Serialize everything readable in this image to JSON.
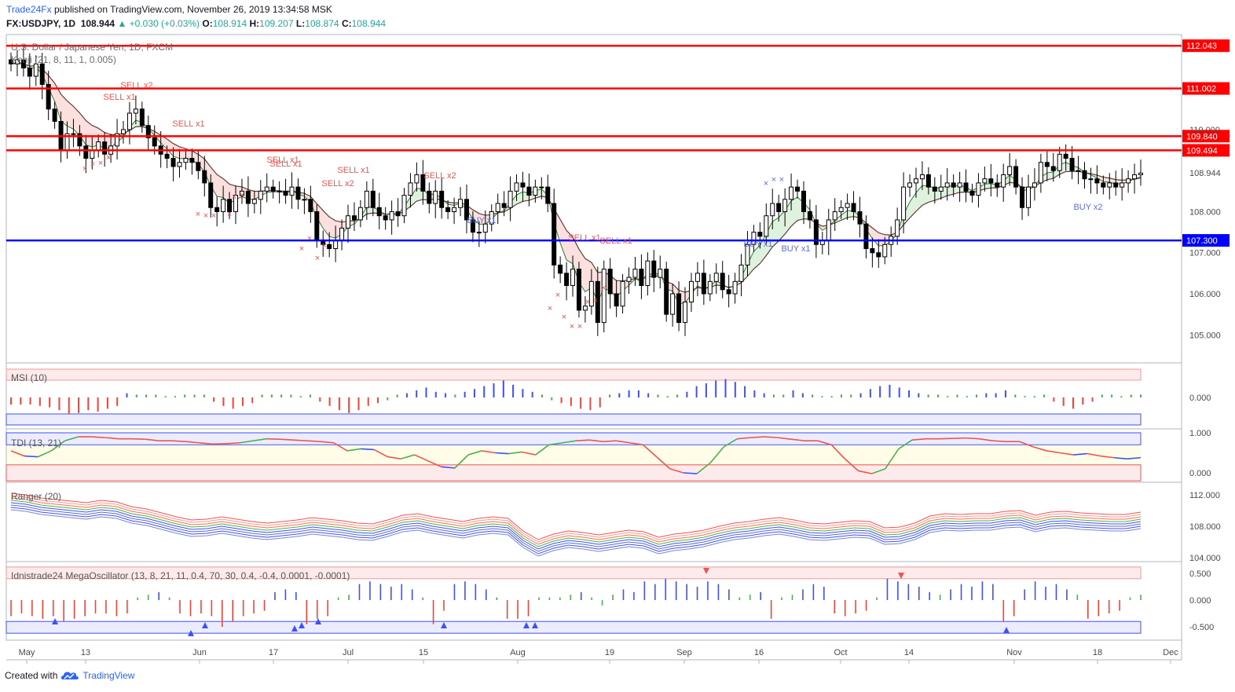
{
  "header": {
    "publisher": "Trade24Fx",
    "published_text": "published on TradingView.com, November 26, 2019 13:34:58 MSK",
    "symbol": "FX:USDJPY, 1D",
    "last": "108.944",
    "change": "▲ +0.030 (+0.03%)",
    "o_label": "O:",
    "o_value": "108.914",
    "h_label": "H:",
    "h_value": "109.207",
    "l_label": "L:",
    "l_value": "108.874",
    "c_label": "C:",
    "c_value": "108.944"
  },
  "footer": {
    "created_with": "Created with",
    "brand": "TradingView"
  },
  "colors": {
    "bull": "#ffffff",
    "bear": "#000000",
    "red_level": "#ff0000",
    "blue_level": "#0000ff",
    "sell": "#ef5350",
    "buy": "#5b6ee1",
    "up_bar": "#3f51f5",
    "down_bar": "#f44336",
    "neutral_bar": "#4caf50"
  },
  "chart_data": [
    {
      "pane": "price",
      "type": "candlestick",
      "title": "U.S. Dollar / Japanese Yen, 1D, FXCM",
      "indicator_label": "Kenji (21, 8, 11, 1, 0.005)",
      "ylim": [
        104.45,
        112.2
      ],
      "y_ticks": [
        "105.000",
        "106.000",
        "107.000",
        "108.000",
        "108.944",
        "110.000"
      ],
      "x_tick_labels": [
        "May",
        "13",
        "Jun",
        "17",
        "Jul",
        "15",
        "Aug",
        "19",
        "Sep",
        "16",
        "Oct",
        "14",
        "Nov",
        "18",
        "Dec"
      ],
      "horizontal_levels": [
        {
          "value": 112.043,
          "label": "112.043",
          "color": "red"
        },
        {
          "value": 111.002,
          "label": "111.002",
          "color": "red"
        },
        {
          "value": 109.84,
          "label": "109.840",
          "color": "red"
        },
        {
          "value": 109.494,
          "label": "109.494",
          "color": "red"
        },
        {
          "value": 107.3,
          "label": "107.300",
          "color": "blue"
        }
      ],
      "last_price_label": "108.944",
      "close": [
        111.6,
        111.7,
        111.5,
        111.3,
        111.6,
        111.1,
        110.5,
        110.2,
        109.5,
        109.9,
        109.9,
        109.6,
        109.3,
        109.5,
        109.7,
        109.4,
        109.6,
        109.9,
        110.0,
        110.4,
        110.5,
        110.1,
        109.8,
        109.6,
        109.4,
        109.3,
        109.1,
        109.2,
        109.3,
        109.2,
        109.0,
        108.7,
        108.1,
        108.0,
        108.3,
        108.0,
        108.4,
        108.5,
        108.2,
        108.3,
        108.5,
        108.6,
        108.5,
        108.5,
        108.4,
        108.6,
        108.3,
        108.3,
        108.0,
        107.3,
        107.2,
        107.1,
        107.3,
        107.6,
        107.9,
        107.8,
        108.1,
        108.5,
        108.1,
        107.9,
        107.8,
        108.0,
        107.9,
        108.4,
        108.7,
        108.9,
        108.5,
        108.2,
        108.5,
        108.1,
        108.0,
        108.1,
        108.3,
        107.8,
        107.5,
        107.5,
        107.7,
        108.0,
        108.2,
        108.1,
        108.5,
        108.7,
        108.6,
        108.4,
        108.6,
        108.6,
        108.2,
        106.7,
        106.5,
        106.2,
        106.6,
        105.6,
        105.7,
        106.3,
        105.3,
        106.6,
        106.0,
        105.7,
        106.3,
        106.4,
        106.6,
        106.2,
        106.8,
        106.4,
        106.6,
        105.5,
        106.0,
        105.3,
        105.8,
        106.3,
        106.5,
        106.0,
        106.3,
        106.5,
        106.1,
        106.0,
        106.3,
        106.7,
        107.2,
        107.5,
        107.4,
        107.9,
        108.2,
        108.0,
        108.3,
        108.6,
        108.5,
        108.0,
        107.8,
        107.2,
        107.3,
        107.8,
        108.0,
        108.1,
        108.2,
        108.0,
        107.7,
        107.1,
        107.0,
        106.9,
        107.2,
        107.4,
        107.8,
        108.6,
        108.7,
        108.8,
        108.9,
        108.6,
        108.5,
        108.6,
        108.7,
        108.6,
        108.7,
        108.5,
        108.4,
        108.7,
        108.8,
        108.7,
        108.6,
        108.9,
        109.1,
        108.6,
        108.1,
        108.6,
        108.7,
        109.2,
        109.1,
        109.0,
        109.4,
        109.3,
        109.0,
        109.0,
        108.8,
        108.8,
        108.7,
        108.6,
        108.7,
        108.6,
        108.7,
        108.8,
        108.9,
        108.94
      ]
    },
    {
      "pane": "msi",
      "type": "bar",
      "title": "MSI (10)",
      "y_ticks": [
        "0.000"
      ],
      "values": [
        -0.5,
        -0.5,
        -0.5,
        -0.6,
        -0.7,
        -0.9,
        -1.2,
        -1.1,
        -0.9,
        -1.0,
        -0.8,
        -0.6,
        0.3,
        0.2,
        0.2,
        0.2,
        0.1,
        0.1,
        0.2,
        0.2,
        0.2,
        -0.3,
        -0.6,
        -0.8,
        -0.6,
        -0.4,
        0.2,
        0.2,
        0.2,
        0.2,
        0.1,
        0.2,
        -0.3,
        -0.6,
        -0.9,
        -1.1,
        -0.9,
        -0.6,
        -0.4,
        -0.2,
        0.2,
        0.3,
        0.5,
        0.7,
        0.4,
        0.3,
        0.2,
        0.4,
        0.6,
        0.8,
        1.0,
        1.2,
        0.9,
        0.6,
        0.4,
        0.2,
        -0.2,
        -0.4,
        -0.6,
        -0.8,
        -0.9,
        -0.7,
        0.2,
        0.3,
        0.5,
        0.5,
        0.3,
        0.2,
        0.1,
        0.2,
        0.4,
        0.8,
        1.0,
        1.2,
        1.3,
        1.1,
        0.8,
        0.5,
        0.3,
        0.2,
        0.2,
        0.5,
        0.3,
        0.2,
        0.1,
        0.1,
        0.2,
        0.2,
        0.3,
        0.6,
        0.8,
        0.9,
        0.7,
        0.5,
        0.3,
        0.2,
        0.2,
        0.1,
        0.2,
        0.1,
        0.2,
        0.3,
        0.3,
        0.5,
        0.2,
        0.1,
        0.1,
        0.2,
        -0.3,
        -0.6,
        -0.8,
        -0.5,
        -0.3,
        0.2,
        0.2,
        0.1,
        0.2,
        0.2
      ]
    },
    {
      "pane": "tdi",
      "type": "line",
      "title": "TDI (13, 21)",
      "y_ticks": [
        "1.000",
        "0.000"
      ],
      "values": [
        0.55,
        0.42,
        0.4,
        0.55,
        0.8,
        0.9,
        0.9,
        0.88,
        0.85,
        0.85,
        0.84,
        0.8,
        0.8,
        0.78,
        0.75,
        0.72,
        0.73,
        0.75,
        0.8,
        0.85,
        0.84,
        0.82,
        0.8,
        0.78,
        0.75,
        0.55,
        0.6,
        0.58,
        0.4,
        0.35,
        0.45,
        0.3,
        0.15,
        0.12,
        0.45,
        0.55,
        0.5,
        0.48,
        0.52,
        0.45,
        0.7,
        0.75,
        0.8,
        0.82,
        0.78,
        0.8,
        0.75,
        0.7,
        0.4,
        0.1,
        0.0,
        -0.02,
        0.25,
        0.65,
        0.85,
        0.88,
        0.9,
        0.88,
        0.84,
        0.8,
        0.8,
        0.7,
        0.35,
        0.05,
        -0.02,
        0.1,
        0.6,
        0.82,
        0.85,
        0.85,
        0.86,
        0.87,
        0.85,
        0.8,
        0.78,
        0.78,
        0.65,
        0.55,
        0.5,
        0.45,
        0.48,
        0.42,
        0.38,
        0.35,
        0.38
      ]
    },
    {
      "pane": "ranger",
      "type": "line",
      "title": "Ranger (20)",
      "y_ticks": [
        "112.000",
        "108.000",
        "104.000"
      ],
      "values": [
        111.2,
        111.0,
        110.6,
        110.4,
        110.2,
        110.0,
        110.3,
        110.1,
        109.5,
        109.2,
        108.7,
        108.2,
        107.8,
        107.9,
        108.2,
        107.9,
        107.6,
        107.4,
        107.6,
        107.8,
        108.1,
        107.9,
        107.7,
        107.4,
        107.3,
        107.8,
        108.4,
        108.6,
        108.2,
        107.9,
        107.6,
        108.0,
        108.2,
        108.0,
        106.4,
        105.3,
        106.0,
        106.4,
        106.2,
        105.9,
        106.2,
        106.5,
        106.3,
        105.6,
        106.0,
        106.2,
        106.5,
        107.0,
        107.4,
        107.6,
        107.9,
        108.1,
        107.8,
        107.4,
        107.3,
        107.5,
        107.7,
        107.6,
        106.8,
        106.9,
        107.4,
        108.3,
        108.6,
        108.5,
        108.6,
        108.6,
        108.9,
        109.0,
        108.4,
        108.8,
        108.9,
        108.7,
        108.6,
        108.5,
        108.5,
        108.8
      ]
    },
    {
      "pane": "mega_oscillator",
      "type": "bar",
      "title": "Idnistrade24 MegaOscillator (13, 8, 21, 11, 0.4, 70, 30, 0.4, -0.4, 0.0001, -0.0001)",
      "y_ticks": [
        "0.500",
        "0.000",
        "-0.500"
      ],
      "values": [
        -0.3,
        -0.25,
        -0.3,
        -0.35,
        -0.3,
        -0.4,
        -0.35,
        -0.3,
        -0.25,
        -0.25,
        -0.3,
        -0.25,
        0.05,
        0.1,
        0.15,
        0.05,
        -0.25,
        -0.3,
        -0.25,
        -0.3,
        -0.5,
        -0.4,
        -0.3,
        -0.25,
        -0.2,
        0.15,
        0.2,
        0.15,
        -0.45,
        -0.35,
        -0.3,
        0.05,
        0.1,
        0.3,
        0.35,
        0.3,
        0.25,
        0.3,
        0.2,
        0.05,
        -0.45,
        -0.2,
        0.3,
        0.35,
        0.3,
        0.2,
        0.05,
        -0.35,
        -0.35,
        -0.3,
        0.05,
        0.05,
        0.05,
        0.1,
        0.15,
        0.05,
        -0.1,
        0.1,
        0.2,
        0.15,
        0.35,
        0.3,
        0.4,
        0.35,
        0.3,
        0.25,
        0.35,
        0.3,
        0.2,
        0.05,
        0.1,
        0.15,
        -0.35,
        0.05,
        0.1,
        0.2,
        0.3,
        0.25,
        -0.25,
        -0.3,
        -0.25,
        -0.2,
        0.05,
        0.4,
        0.35,
        0.3,
        0.25,
        0.15,
        0.1,
        0.2,
        0.3,
        0.25,
        0.35,
        0.3,
        -0.4,
        -0.3,
        0.2,
        0.35,
        0.25,
        0.3,
        0.2,
        0.1,
        -0.35,
        -0.3,
        -0.25,
        -0.2,
        0.05,
        0.1
      ]
    }
  ],
  "signal_labels": {
    "sell_labels": [
      "SELL x2",
      "SELL x1",
      "SELL x1",
      "SELL x1",
      "SELL x1",
      "SELL x1",
      "SELL x2",
      "SELL x2",
      "SELL x1",
      "SELL x1"
    ],
    "buy_labels": [
      "BUY x1",
      "BUY x1",
      "BUY x1",
      "BUY x2"
    ]
  }
}
